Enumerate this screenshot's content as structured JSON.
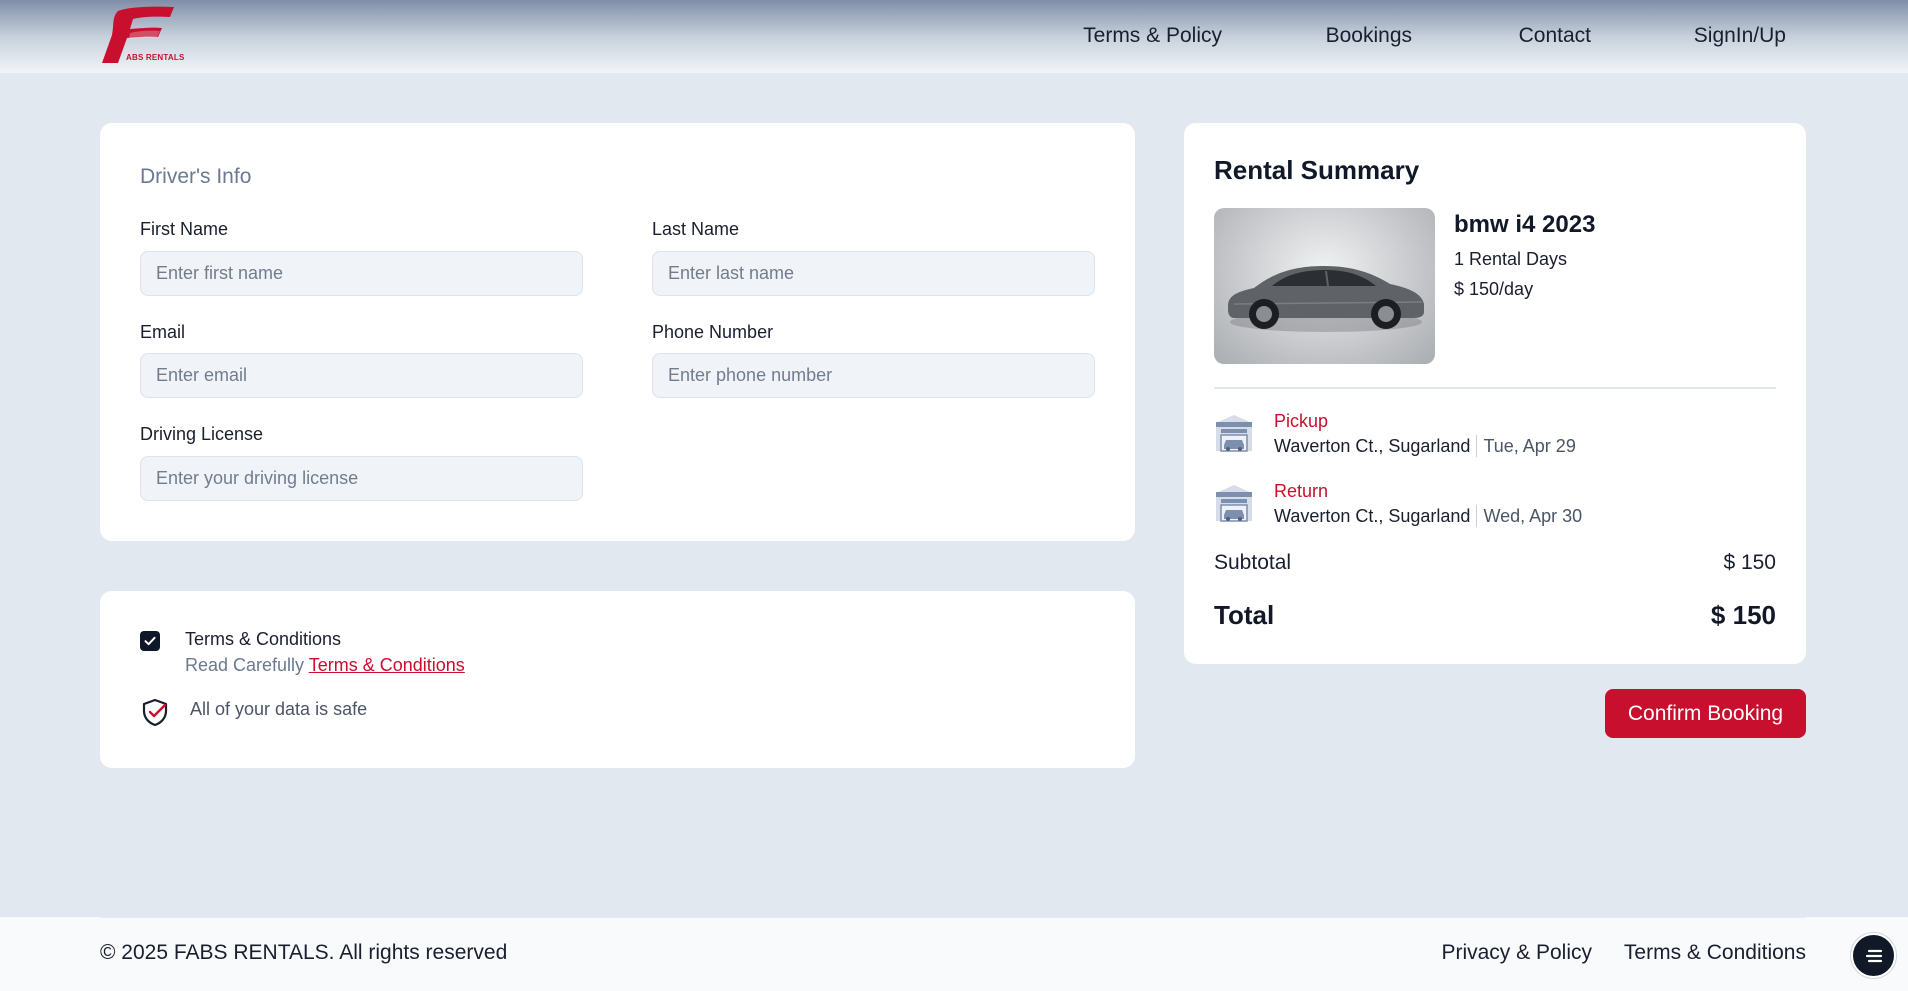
{
  "brand": {
    "name": "FABS RENTALS",
    "logo_text": "ABS RENTALS",
    "accent_color": "#c8102e"
  },
  "nav": {
    "items": [
      {
        "label": "Terms & Policy"
      },
      {
        "label": "Bookings"
      },
      {
        "label": "Contact"
      },
      {
        "label": "SignIn/Up"
      }
    ]
  },
  "drivers_info": {
    "title": "Driver's Info",
    "first_name": {
      "label": "First Name",
      "placeholder": "Enter first name",
      "value": ""
    },
    "last_name": {
      "label": "Last Name",
      "placeholder": "Enter last name",
      "value": ""
    },
    "email": {
      "label": "Email",
      "placeholder": "Enter email",
      "value": ""
    },
    "phone": {
      "label": "Phone Number",
      "placeholder": "Enter phone number",
      "value": ""
    },
    "license": {
      "label": "Driving License",
      "placeholder": "Enter your driving license",
      "value": ""
    }
  },
  "terms": {
    "checked": true,
    "title": "Terms & Conditions",
    "read_prefix": "Read Carefully",
    "link_label": "Terms & Conditions",
    "safe_text": "All of your data is safe"
  },
  "summary": {
    "title": "Rental Summary",
    "car": {
      "name": "bmw i4 2023",
      "days": "1 Rental Days",
      "price_per_day": "$ 150/day"
    },
    "pickup": {
      "label": "Pickup",
      "place": "Waverton Ct., Sugarland",
      "date": "Tue, Apr 29"
    },
    "return": {
      "label": "Return",
      "place": "Waverton Ct., Sugarland",
      "date": "Wed, Apr 30"
    },
    "subtotal_label": "Subtotal",
    "subtotal_value": "$ 150",
    "total_label": "Total",
    "total_value": "$ 150"
  },
  "confirm_label": "Confirm Booking",
  "footer": {
    "copyright": "© 2025 FABS RENTALS. All rights reserved",
    "links": [
      {
        "label": "Privacy & Policy"
      },
      {
        "label": "Terms & Conditions"
      }
    ]
  },
  "icons": {
    "logo": "fabs-logo-icon",
    "checkbox": "checkmark-icon",
    "shield": "shield-check-icon",
    "garage": "garage-car-icon",
    "chat": "menu-lines-icon"
  }
}
